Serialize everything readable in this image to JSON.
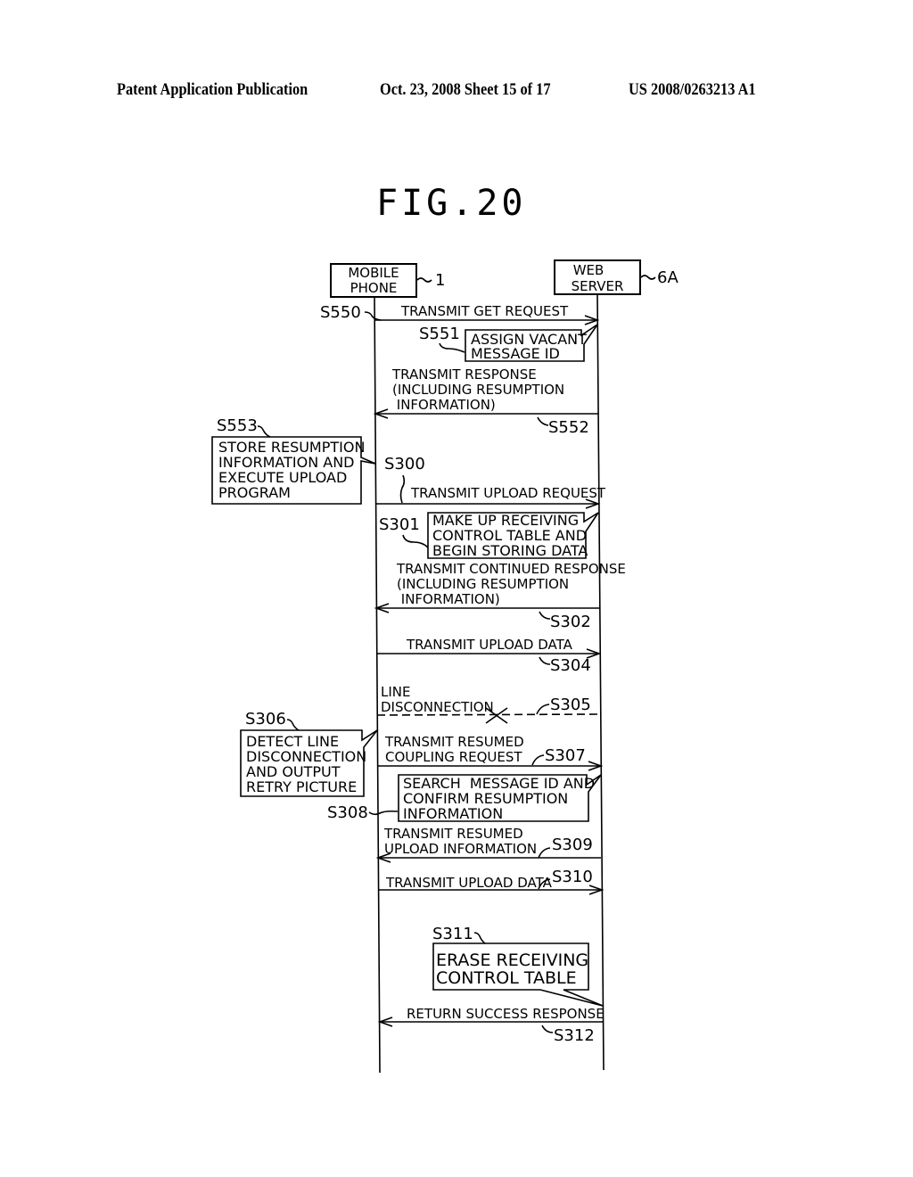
{
  "header": {
    "left": "Patent Application Publication",
    "middle": "Oct. 23, 2008  Sheet 15 of 17",
    "right": "US 2008/0263213 A1"
  },
  "figure": {
    "title": "FIG.20"
  },
  "actors": {
    "mobile": {
      "lines": [
        "MOBILE",
        "PHONE"
      ],
      "ref": "1"
    },
    "server": {
      "lines": [
        "WEB",
        "SERVER"
      ],
      "ref": "6A"
    }
  },
  "steps": {
    "s550": {
      "id": "S550",
      "label": "TRANSMIT GET REQUEST"
    },
    "s551": {
      "id": "S551",
      "lines": [
        "ASSIGN VACANT",
        "MESSAGE ID"
      ]
    },
    "s552": {
      "id": "S552",
      "lines": [
        "TRANSMIT RESPONSE",
        "(INCLUDING RESUMPTION",
        " INFORMATION)"
      ]
    },
    "s553": {
      "id": "S553",
      "lines": [
        "STORE RESUMPTION",
        "INFORMATION AND",
        "EXECUTE UPLOAD",
        "PROGRAM"
      ]
    },
    "s300": {
      "id": "S300",
      "label": "TRANSMIT UPLOAD REQUEST"
    },
    "s301": {
      "id": "S301",
      "lines": [
        "MAKE UP RECEIVING",
        "CONTROL TABLE AND",
        "BEGIN STORING DATA"
      ]
    },
    "s302": {
      "id": "S302",
      "lines": [
        "TRANSMIT CONTINUED RESPONSE",
        "(INCLUDING RESUMPTION",
        " INFORMATION)"
      ]
    },
    "s304": {
      "id": "S304",
      "label": "TRANSMIT UPLOAD DATA"
    },
    "s305": {
      "id": "S305",
      "lines": [
        "LINE",
        "DISCONNECTION"
      ]
    },
    "s306": {
      "id": "S306",
      "lines": [
        "DETECT LINE",
        "DISCONNECTION",
        "AND OUTPUT",
        "RETRY PICTURE"
      ]
    },
    "s307": {
      "id": "S307",
      "lines": [
        "TRANSMIT RESUMED",
        "COUPLING REQUEST"
      ]
    },
    "s308": {
      "id": "S308",
      "lines": [
        "SEARCH  MESSAGE ID AND",
        "CONFIRM RESUMPTION",
        "INFORMATION"
      ]
    },
    "s309": {
      "id": "S309",
      "lines": [
        "TRANSMIT RESUMED",
        "UPLOAD INFORMATION"
      ]
    },
    "s310": {
      "id": "S310",
      "label": "TRANSMIT UPLOAD DATA"
    },
    "s311": {
      "id": "S311",
      "lines": [
        "ERASE RECEIVING",
        "CONTROL TABLE"
      ]
    },
    "s312": {
      "id": "S312",
      "label": "RETURN SUCCESS RESPONSE"
    }
  }
}
